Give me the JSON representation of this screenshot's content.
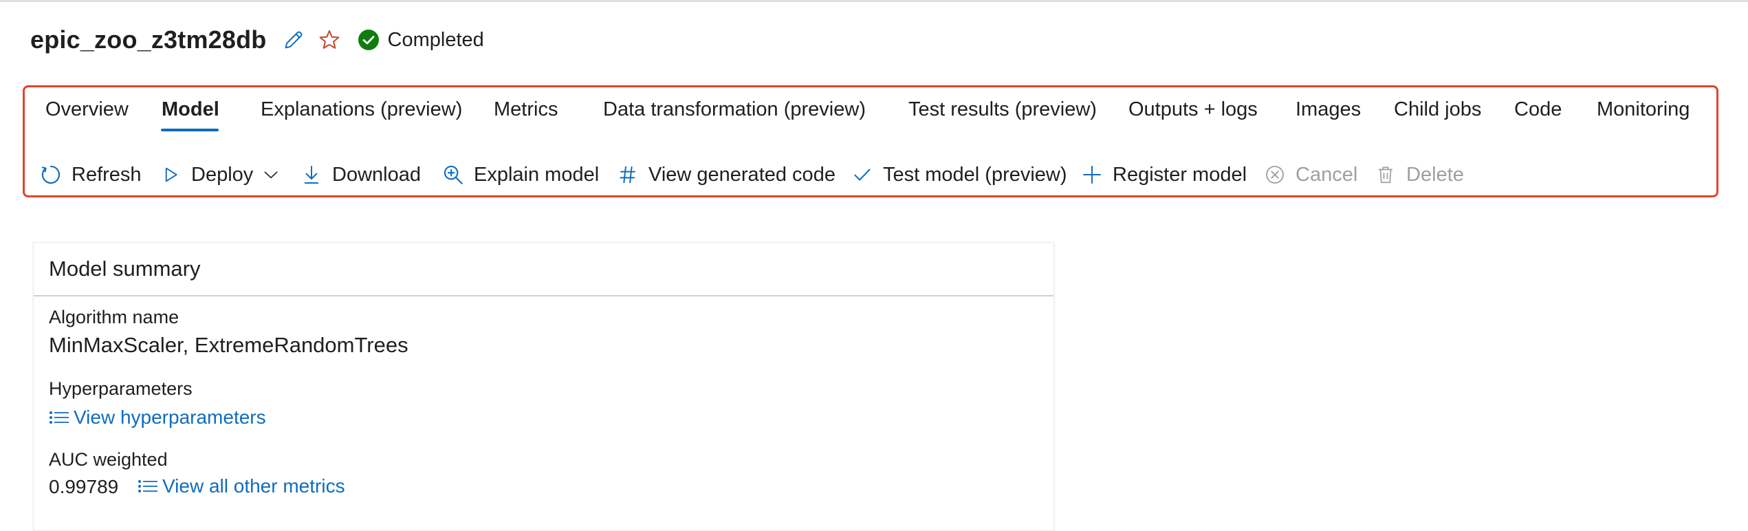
{
  "header": {
    "title": "epic_zoo_z3tm28db",
    "edit_icon": "pencil-icon",
    "favorite_icon": "star-icon",
    "status": "Completed",
    "status_color": "#107c10"
  },
  "tabs": [
    {
      "label": "Overview",
      "active": false
    },
    {
      "label": "Model",
      "active": true
    },
    {
      "label": "Explanations (preview)",
      "active": false
    },
    {
      "label": "Metrics",
      "active": false
    },
    {
      "label": "Data transformation (preview)",
      "active": false
    },
    {
      "label": "Test results (preview)",
      "active": false
    },
    {
      "label": "Outputs + logs",
      "active": false
    },
    {
      "label": "Images",
      "active": false
    },
    {
      "label": "Child jobs",
      "active": false
    },
    {
      "label": "Code",
      "active": false
    },
    {
      "label": "Monitoring",
      "active": false
    }
  ],
  "toolbar": {
    "refresh": "Refresh",
    "deploy": "Deploy",
    "download": "Download",
    "explain_model": "Explain model",
    "view_generated_code": "View generated code",
    "test_model": "Test model (preview)",
    "register_model": "Register model",
    "cancel": "Cancel",
    "delete": "Delete"
  },
  "summary": {
    "title": "Model summary",
    "algorithm_label": "Algorithm name",
    "algorithm_value": "MinMaxScaler, ExtremeRandomTrees",
    "hyperparameters_label": "Hyperparameters",
    "view_hyperparameters": "View hyperparameters",
    "auc_label": "AUC weighted",
    "auc_value": "0.99789",
    "view_all_metrics": "View all other metrics"
  },
  "colors": {
    "accent": "#0f6cbd",
    "highlight_border": "#e0442c",
    "disabled": "#a19f9d"
  }
}
